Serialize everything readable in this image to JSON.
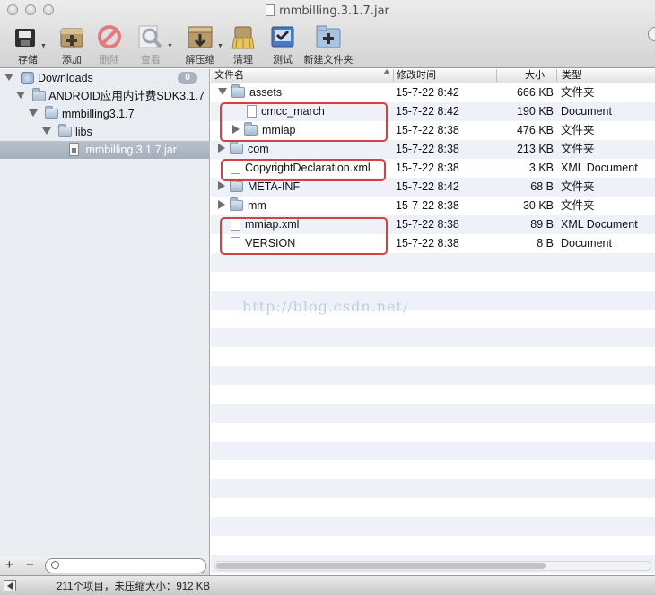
{
  "window": {
    "title": "mmbilling.3.1.7.jar"
  },
  "toolbar": [
    {
      "label": "存储",
      "icon": "save-icon",
      "has_menu": true,
      "enabled": true
    },
    {
      "label": "添加",
      "icon": "add-icon",
      "has_menu": false,
      "enabled": true
    },
    {
      "label": "删除",
      "icon": "delete-icon",
      "has_menu": false,
      "enabled": false
    },
    {
      "label": "查看",
      "icon": "view-icon",
      "has_menu": true,
      "enabled": false
    },
    {
      "label": "解压缩",
      "icon": "extract-icon",
      "has_menu": true,
      "enabled": true
    },
    {
      "label": "清理",
      "icon": "clean-icon",
      "has_menu": false,
      "enabled": true
    },
    {
      "label": "测试",
      "icon": "test-icon",
      "has_menu": false,
      "enabled": true
    },
    {
      "label": "新建文件夹",
      "icon": "new-folder-icon",
      "has_menu": false,
      "enabled": true
    }
  ],
  "sidebar": {
    "items": [
      {
        "label": "Downloads",
        "icon": "downloads-icon",
        "badge": "0",
        "expanded": true
      },
      {
        "label": "ANDROID应用内计费SDK3.1.7",
        "icon": "folder-icon",
        "expanded": true
      },
      {
        "label": "mmbilling3.1.7",
        "icon": "folder-icon",
        "expanded": true
      },
      {
        "label": "libs",
        "icon": "folder-icon",
        "expanded": true
      },
      {
        "label": "mmbilling.3.1.7.jar",
        "icon": "jar-icon",
        "selected": true
      }
    ]
  },
  "columns": {
    "name": "文件名",
    "date": "修改时间",
    "size": "大小",
    "kind": "类型"
  },
  "files": [
    {
      "name": "assets",
      "date": "15-7-22 8:42",
      "size": "666 KB",
      "kind": "文件夹",
      "type": "folder",
      "disclosure": "open"
    },
    {
      "name": "cmcc_march",
      "date": "15-7-22 8:42",
      "size": "190 KB",
      "kind": "Document",
      "type": "file",
      "disclosure": "none"
    },
    {
      "name": "mmiap",
      "date": "15-7-22 8:38",
      "size": "476 KB",
      "kind": "文件夹",
      "type": "folder",
      "disclosure": "closed"
    },
    {
      "name": "com",
      "date": "15-7-22 8:38",
      "size": "213 KB",
      "kind": "文件夹",
      "type": "folder",
      "disclosure": "closed"
    },
    {
      "name": "CopyrightDeclaration.xml",
      "date": "15-7-22 8:38",
      "size": "3 KB",
      "kind": "XML Document",
      "type": "file",
      "disclosure": "none"
    },
    {
      "name": "META-INF",
      "date": "15-7-22 8:42",
      "size": "68 B",
      "kind": "文件夹",
      "type": "folder",
      "disclosure": "closed"
    },
    {
      "name": "mm",
      "date": "15-7-22 8:38",
      "size": "30 KB",
      "kind": "文件夹",
      "type": "folder",
      "disclosure": "closed"
    },
    {
      "name": "mmiap.xml",
      "date": "15-7-22 8:38",
      "size": "89 B",
      "kind": "XML Document",
      "type": "file",
      "disclosure": "none"
    },
    {
      "name": "VERSION",
      "date": "15-7-22 8:38",
      "size": "8 B",
      "kind": "Document",
      "type": "file",
      "disclosure": "none"
    }
  ],
  "watermark": "http://blog.csdn.net/",
  "search": {
    "placeholder": ""
  },
  "status": {
    "text": "211个项目，未压缩大小：912 KB"
  },
  "colors": {
    "highlight_box": "#d64040",
    "selection": "#a5afbd",
    "row_stripe": "#eef2f8"
  }
}
